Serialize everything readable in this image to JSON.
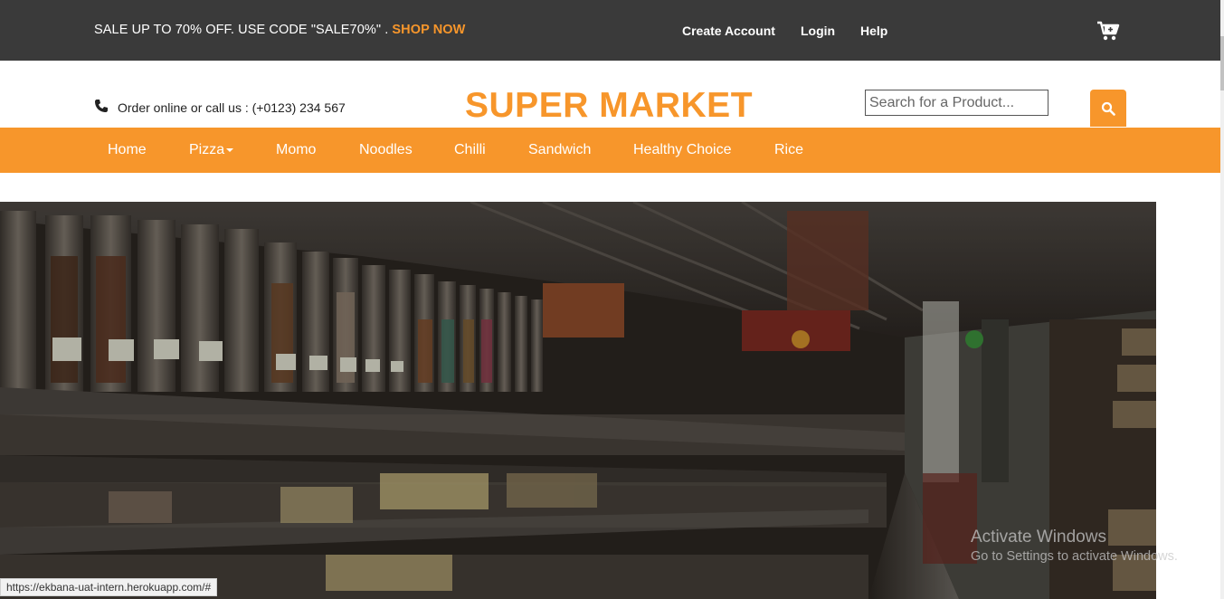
{
  "promo": {
    "text": "SALE UP TO 70% OFF. USE CODE \"SALE70%\" .",
    "link": "SHOP NOW"
  },
  "account_links": {
    "create_account": "Create Account",
    "login": "Login",
    "help": "Help"
  },
  "contact": {
    "text": "Order online or call us : (+0123) 234 567"
  },
  "brand": {
    "title": "SUPER MARKET"
  },
  "search": {
    "placeholder": "Search for a Product..."
  },
  "nav": {
    "items": [
      {
        "label": "Home"
      },
      {
        "label": "Pizza",
        "has_dropdown": true
      },
      {
        "label": "Momo"
      },
      {
        "label": "Noodles"
      },
      {
        "label": "Chilli"
      },
      {
        "label": "Sandwich"
      },
      {
        "label": "Healthy Choice"
      },
      {
        "label": "Rice"
      }
    ]
  },
  "status_bar": {
    "url": "https://ekbana-uat-intern.herokuapp.com/#"
  },
  "watermark": {
    "title": "Activate Windows",
    "subtitle": "Go to Settings to activate Windows."
  },
  "icons": {
    "cart": "cart-icon",
    "phone": "phone-icon",
    "search": "search-icon"
  },
  "colors": {
    "accent": "#f7962b",
    "topbar": "#3a3a3a"
  }
}
